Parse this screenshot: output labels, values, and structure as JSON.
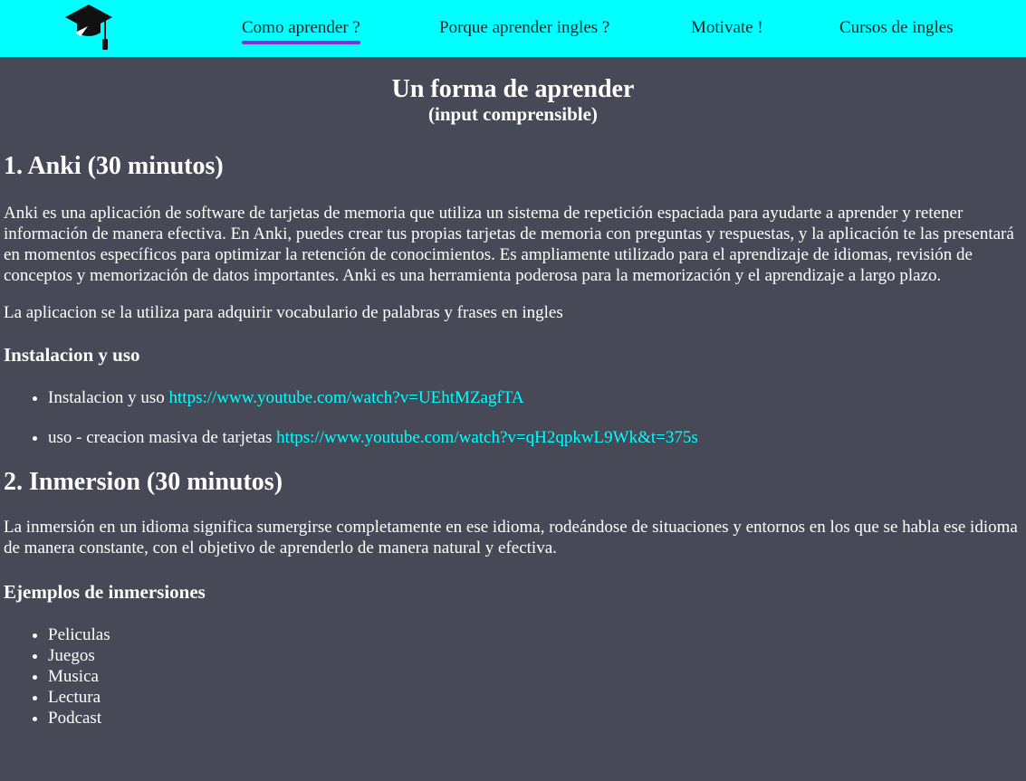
{
  "nav": {
    "logo_icon": "graduation-cap-icon",
    "items": [
      {
        "label": "Como aprender ?"
      },
      {
        "label": "Porque aprender ingles ?"
      },
      {
        "label": "Motivate !"
      },
      {
        "label": "Cursos de ingles"
      }
    ],
    "active_index": 0
  },
  "hero": {
    "title": "Un forma de aprender",
    "subtitle": "(input comprensible)"
  },
  "sections": [
    {
      "title": "1. Anki (30 minutos)",
      "paragraphs": [
        "Anki es una aplicación de software de tarjetas de memoria que utiliza un sistema de repetición espaciada para ayudarte a aprender y retener información de manera efectiva. En Anki, puedes crear tus propias tarjetas de memoria con preguntas y respuestas, y la aplicación te las presentará en momentos específicos para optimizar la retención de conocimientos. Es ampliamente utilizado para el aprendizaje de idiomas, revisión de conceptos y memorización de datos importantes. Anki es una herramienta poderosa para la memorización y el aprendizaje a largo plazo.",
        "La aplicacion se la utiliza para adquirir vocabulario de palabras y frases en ingles"
      ],
      "subtitle": "Instalacion y uso",
      "items": [
        {
          "text": "Instalacion y uso ",
          "link": "https://www.youtube.com/watch?v=UEhtMZagfTA"
        },
        {
          "text": "uso - creacion masiva de tarjetas ",
          "link": "https://www.youtube.com/watch?v=qH2qpkwL9Wk&t=375s"
        }
      ]
    },
    {
      "title": "2. Inmersion (30 minutos)",
      "paragraphs": [
        "La inmersión en un idioma significa sumergirse completamente en ese idioma, rodeándose de situaciones y entornos en los que se habla ese idioma de manera constante, con el objetivo de aprenderlo de manera natural y efectiva."
      ],
      "subtitle": "Ejemplos de inmersiones",
      "items": [
        {
          "text": "Peliculas"
        },
        {
          "text": "Juegos"
        },
        {
          "text": "Musica"
        },
        {
          "text": "Lectura"
        },
        {
          "text": "Podcast"
        }
      ]
    }
  ],
  "colors": {
    "nav_background": "#00ffff",
    "page_background": "#474a56",
    "active_underline": "#8a2be2",
    "link": "#00ffff"
  }
}
